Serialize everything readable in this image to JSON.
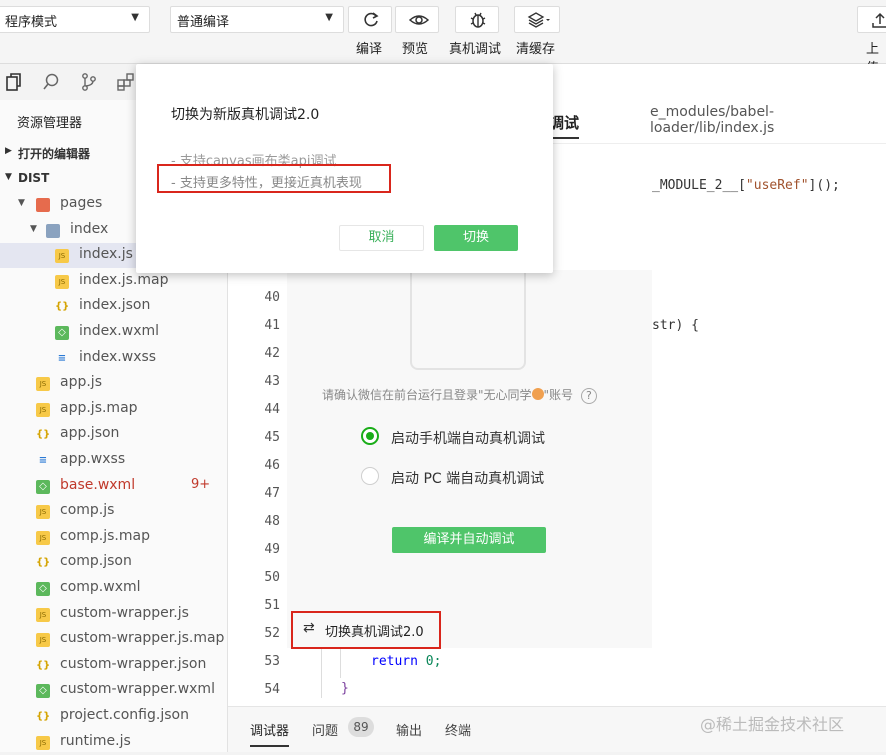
{
  "toolbar": {
    "mode_select": "程序模式",
    "compile_select": "普通编译",
    "compile_label": "编译",
    "preview_label": "预览",
    "device_debug_label": "真机调试",
    "clear_cache_label": "清缓存",
    "upload_label": "上传"
  },
  "sidebar": {
    "title": "资源管理器",
    "open_editors": "打开的编辑器",
    "dist": "DIST",
    "files": [
      {
        "name": "pages",
        "type": "pfolder"
      },
      {
        "name": "index",
        "type": "folder"
      },
      {
        "name": "index.js",
        "type": "js"
      },
      {
        "name": "index.js.map",
        "type": "js"
      },
      {
        "name": "index.json",
        "type": "json"
      },
      {
        "name": "index.wxml",
        "type": "wxml"
      },
      {
        "name": "index.wxss",
        "type": "wxss"
      },
      {
        "name": "app.js",
        "type": "js"
      },
      {
        "name": "app.js.map",
        "type": "js"
      },
      {
        "name": "app.json",
        "type": "json"
      },
      {
        "name": "app.wxss",
        "type": "wxss"
      },
      {
        "name": "base.wxml",
        "type": "wxml",
        "badge": "9+"
      },
      {
        "name": "comp.js",
        "type": "js"
      },
      {
        "name": "comp.js.map",
        "type": "js"
      },
      {
        "name": "comp.json",
        "type": "json"
      },
      {
        "name": "comp.wxml",
        "type": "wxml"
      },
      {
        "name": "custom-wrapper.js",
        "type": "js"
      },
      {
        "name": "custom-wrapper.js.map",
        "type": "js"
      },
      {
        "name": "custom-wrapper.json",
        "type": "json"
      },
      {
        "name": "custom-wrapper.wxml",
        "type": "wxml"
      },
      {
        "name": "project.config.json",
        "type": "json"
      },
      {
        "name": "runtime.js",
        "type": "js"
      }
    ]
  },
  "editor": {
    "path": "e_modules/babel-loader/lib/index.js",
    "debug_tab": "调试",
    "code_useRef_prefix": "_MODULE_2__[",
    "code_useRef_string": "\"useRef\"",
    "code_useRef_suffix": "]();",
    "code_str": "str) {",
    "code_return_kw": "return",
    "code_return_val": "0;",
    "code_brace": "}",
    "line_numbers": [
      "40",
      "41",
      "42",
      "43",
      "44",
      "45",
      "46",
      "47",
      "48",
      "49",
      "50",
      "51",
      "52",
      "53",
      "54"
    ]
  },
  "panel": {
    "hint_prefix": "请确认微信在前台运行且登录\"无心同学",
    "hint_suffix": "\"账号",
    "opt_mobile": "启动手机端自动真机调试",
    "opt_pc": "启动 PC 端自动真机调试",
    "compile_debug_btn": "编译并自动调试",
    "switch_label": "切换真机调试2.0"
  },
  "dialog": {
    "title": "切换为新版真机调试2.0",
    "line1": "- 支持canvas画布类api调试",
    "line2": "- 支持更多特性，更接近真机表现",
    "cancel": "取消",
    "confirm": "切换"
  },
  "bottom": {
    "tab_debugger": "调试器",
    "tab_issues": "问题",
    "issues_count": "89",
    "tab_output": "输出",
    "tab_terminal": "终端"
  },
  "watermark": "@稀土掘金技术社区"
}
